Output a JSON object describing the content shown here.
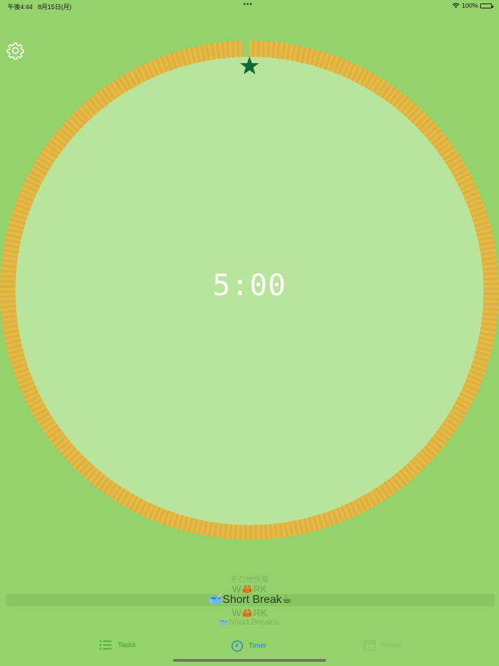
{
  "status_bar": {
    "time": "午後4:44",
    "date": "8月15日(月)",
    "multitask_dots": "•••",
    "battery_text": "100%"
  },
  "timer": {
    "display": "5:00"
  },
  "picker": {
    "items": [
      "その他作業",
      "W🦀RK",
      "🥣Short Break☕",
      "W🦀RK",
      "🥣Short Break☕"
    ],
    "selected_index": 2
  },
  "tabs": [
    {
      "label": "Tasks",
      "icon": "list-icon"
    },
    {
      "label": "Timer",
      "icon": "clock-icon",
      "selected": true
    },
    {
      "label": "Report",
      "icon": "calendar-icon"
    }
  ],
  "colors": {
    "background": "#94d26b",
    "ring": "#e4b83f",
    "face": "#b9e49b",
    "star": "#0d6b35",
    "active_tab": "#1f7ee0"
  }
}
